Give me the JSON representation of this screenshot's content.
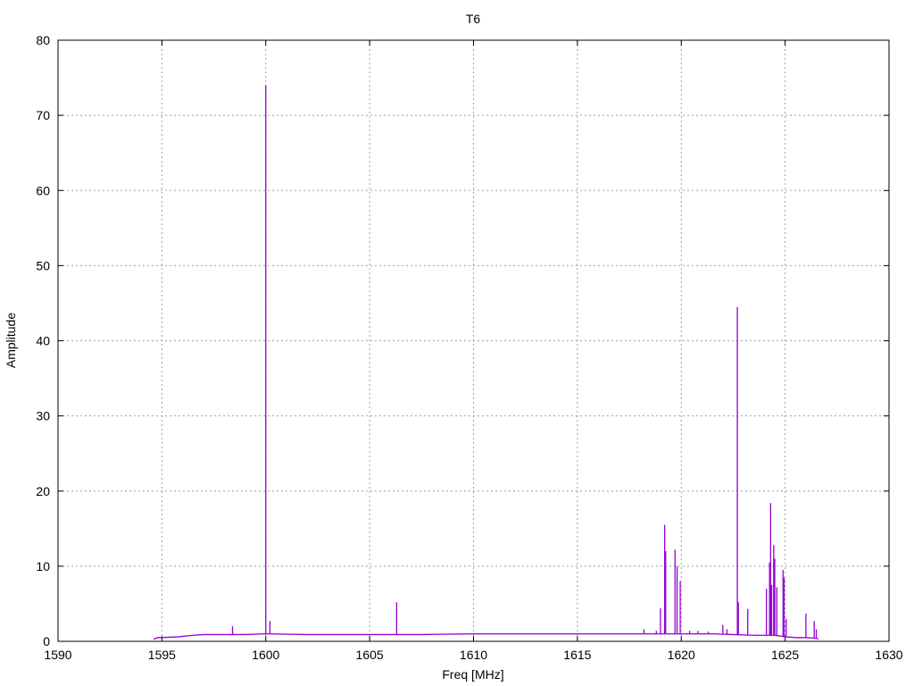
{
  "chart_data": {
    "type": "line",
    "title": "T6",
    "xlabel": "Freq [MHz]",
    "ylabel": "Amplitude",
    "xlim": [
      1590,
      1630
    ],
    "ylim": [
      0,
      80
    ],
    "xticks": [
      1590,
      1595,
      1600,
      1605,
      1610,
      1615,
      1620,
      1625,
      1630
    ],
    "yticks": [
      0,
      10,
      20,
      30,
      40,
      50,
      60,
      70,
      80
    ],
    "grid": true,
    "line_color": "#9400d3",
    "series": [
      {
        "name": "T6",
        "baseline": [
          [
            1594.6,
            0.3
          ],
          [
            1594.8,
            0.5
          ],
          [
            1595.0,
            0.5
          ],
          [
            1595.8,
            0.6
          ],
          [
            1596.5,
            0.8
          ],
          [
            1597.0,
            0.9
          ],
          [
            1598.0,
            0.9
          ],
          [
            1599.0,
            0.9
          ],
          [
            1599.9,
            1.0
          ],
          [
            1600.1,
            1.0
          ],
          [
            1602.0,
            0.9
          ],
          [
            1603.0,
            0.9
          ],
          [
            1604.0,
            0.9
          ],
          [
            1605.0,
            0.9
          ],
          [
            1606.0,
            0.9
          ],
          [
            1607.5,
            0.9
          ],
          [
            1610.0,
            1.0
          ],
          [
            1612.0,
            1.0
          ],
          [
            1614.0,
            1.0
          ],
          [
            1616.0,
            1.0
          ],
          [
            1618.0,
            1.0
          ],
          [
            1619.0,
            1.0
          ],
          [
            1620.0,
            1.0
          ],
          [
            1621.5,
            1.0
          ],
          [
            1622.5,
            0.9
          ],
          [
            1623.5,
            0.8
          ],
          [
            1624.5,
            0.8
          ],
          [
            1625.0,
            0.6
          ],
          [
            1625.5,
            0.5
          ],
          [
            1626.0,
            0.5
          ],
          [
            1626.5,
            0.4
          ],
          [
            1626.6,
            0.3
          ]
        ],
        "peaks": [
          [
            1598.4,
            2.0
          ],
          [
            1600.0,
            74.0
          ],
          [
            1600.2,
            2.7
          ],
          [
            1606.3,
            5.2
          ],
          [
            1618.2,
            1.6
          ],
          [
            1618.8,
            1.4
          ],
          [
            1619.0,
            4.4
          ],
          [
            1619.2,
            15.5
          ],
          [
            1619.25,
            12.0
          ],
          [
            1619.7,
            12.2
          ],
          [
            1619.8,
            10.0
          ],
          [
            1619.95,
            8.0
          ],
          [
            1620.4,
            1.4
          ],
          [
            1620.8,
            1.4
          ],
          [
            1621.3,
            1.3
          ],
          [
            1622.0,
            2.2
          ],
          [
            1622.2,
            1.6
          ],
          [
            1622.7,
            44.5
          ],
          [
            1622.75,
            5.2
          ],
          [
            1623.2,
            4.3
          ],
          [
            1624.1,
            7.0
          ],
          [
            1624.25,
            10.5
          ],
          [
            1624.3,
            18.4
          ],
          [
            1624.35,
            7.5
          ],
          [
            1624.45,
            12.8
          ],
          [
            1624.5,
            11.0
          ],
          [
            1624.6,
            7.2
          ],
          [
            1624.9,
            9.5
          ],
          [
            1624.95,
            8.5
          ],
          [
            1625.05,
            3.0
          ],
          [
            1626.0,
            3.7
          ],
          [
            1626.4,
            2.7
          ],
          [
            1626.5,
            1.6
          ]
        ]
      }
    ]
  }
}
